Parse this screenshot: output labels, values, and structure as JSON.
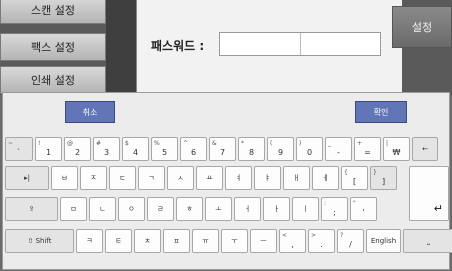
{
  "sidebar": {
    "items": [
      {
        "label": "스캔 설정"
      },
      {
        "label": "팩스 설정"
      },
      {
        "label": "인쇄 설정"
      }
    ]
  },
  "dialog": {
    "password_label": "패스워드 :",
    "password_value": ""
  },
  "right_button": {
    "label": "설정"
  },
  "keyboard": {
    "cancel_label": "취소",
    "ok_label": "확인",
    "row1": [
      {
        "main": "`",
        "sub": "~"
      },
      {
        "main": "1",
        "sub": "!"
      },
      {
        "main": "2",
        "sub": "@"
      },
      {
        "main": "3",
        "sub": "#"
      },
      {
        "main": "4",
        "sub": "$"
      },
      {
        "main": "5",
        "sub": "%"
      },
      {
        "main": "6",
        "sub": "^"
      },
      {
        "main": "7",
        "sub": "&"
      },
      {
        "main": "8",
        "sub": "*"
      },
      {
        "main": "9",
        "sub": "("
      },
      {
        "main": "0",
        "sub": ")"
      },
      {
        "main": "-",
        "sub": "_"
      },
      {
        "main": "=",
        "sub": "+"
      },
      {
        "main": "₩",
        "sub": "|"
      },
      {
        "main": "←",
        "sub": ""
      }
    ],
    "row2": [
      {
        "main": "▸|",
        "sub": ""
      },
      {
        "main": "ㅂ",
        "sub": ""
      },
      {
        "main": "ㅈ",
        "sub": ""
      },
      {
        "main": "ㄷ",
        "sub": ""
      },
      {
        "main": "ㄱ",
        "sub": ""
      },
      {
        "main": "ㅅ",
        "sub": ""
      },
      {
        "main": "ㅛ",
        "sub": ""
      },
      {
        "main": "ㅕ",
        "sub": ""
      },
      {
        "main": "ㅑ",
        "sub": ""
      },
      {
        "main": "ㅐ",
        "sub": ""
      },
      {
        "main": "ㅔ",
        "sub": ""
      },
      {
        "main": "[",
        "sub": "{"
      },
      {
        "main": "]",
        "sub": "}"
      }
    ],
    "row3": [
      {
        "main": "⇪",
        "sub": ""
      },
      {
        "main": "ㅁ",
        "sub": ""
      },
      {
        "main": "ㄴ",
        "sub": ""
      },
      {
        "main": "ㅇ",
        "sub": ""
      },
      {
        "main": "ㄹ",
        "sub": ""
      },
      {
        "main": "ㅎ",
        "sub": ""
      },
      {
        "main": "ㅗ",
        "sub": ""
      },
      {
        "main": "ㅓ",
        "sub": ""
      },
      {
        "main": "ㅏ",
        "sub": ""
      },
      {
        "main": "ㅣ",
        "sub": ""
      },
      {
        "main": ";",
        "sub": ":"
      },
      {
        "main": "'",
        "sub": "\""
      }
    ],
    "row4": [
      {
        "main": "⇧ Shift",
        "sub": ""
      },
      {
        "main": "ㅋ",
        "sub": ""
      },
      {
        "main": "ㅌ",
        "sub": ""
      },
      {
        "main": "ㅊ",
        "sub": ""
      },
      {
        "main": "ㅍ",
        "sub": ""
      },
      {
        "main": "ㅠ",
        "sub": ""
      },
      {
        "main": "ㅜ",
        "sub": ""
      },
      {
        "main": "ㅡ",
        "sub": ""
      },
      {
        "main": ",",
        "sub": "<"
      },
      {
        "main": ".",
        "sub": ">"
      },
      {
        "main": "/",
        "sub": "?"
      },
      {
        "main": "English",
        "sub": ""
      },
      {
        "main": "⎵",
        "sub": ""
      }
    ],
    "enter_label": "↵"
  }
}
